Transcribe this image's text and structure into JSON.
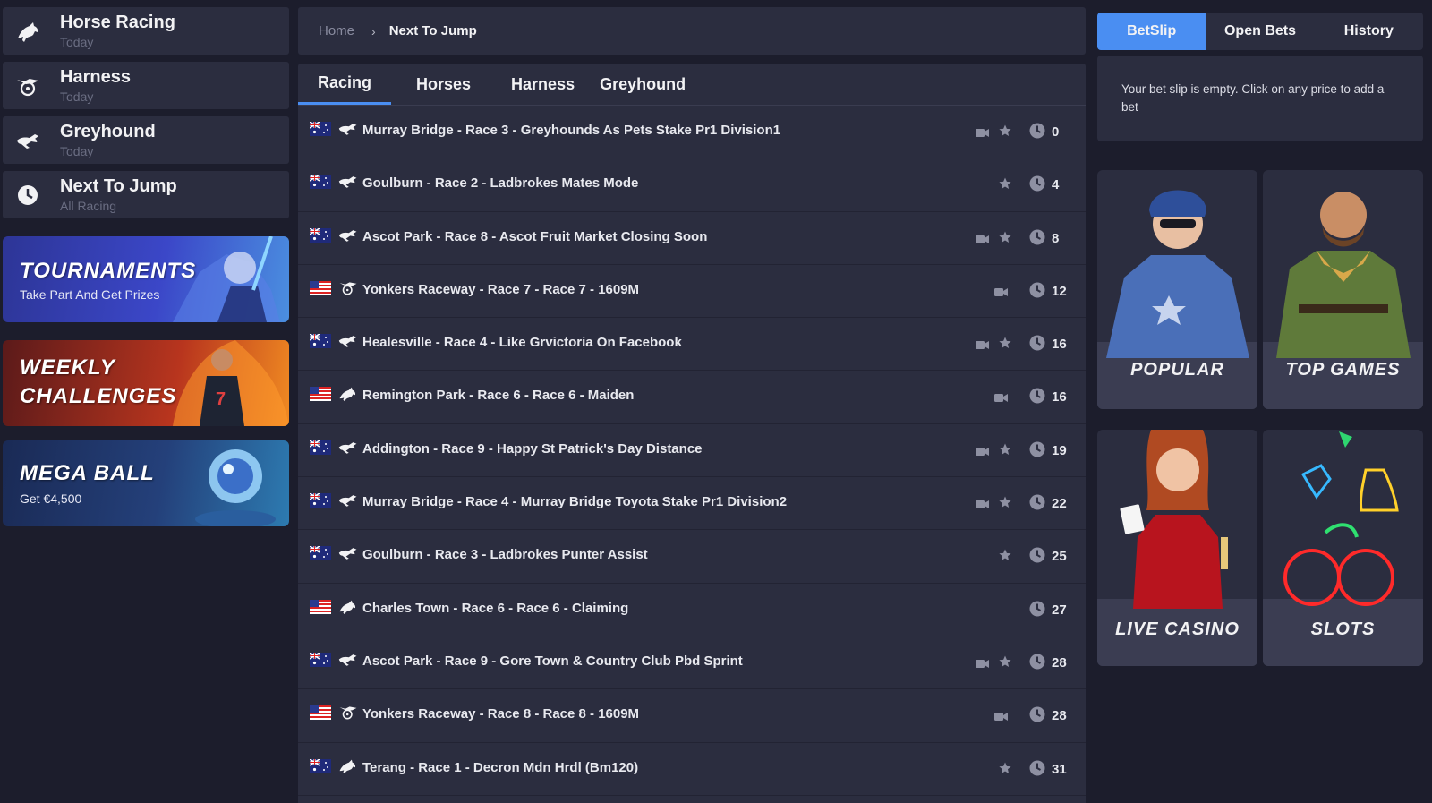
{
  "sidebar": {
    "items": [
      {
        "title": "Horse Racing",
        "subtitle": "Today",
        "icon": "horse-icon"
      },
      {
        "title": "Harness",
        "subtitle": "Today",
        "icon": "harness-icon"
      },
      {
        "title": "Greyhound",
        "subtitle": "Today",
        "icon": "greyhound-icon"
      },
      {
        "title": "Next To Jump",
        "subtitle": "All Racing",
        "icon": "clock-icon"
      }
    ],
    "promos": [
      {
        "title": "TOURNAMENTS",
        "subtitle": "Take Part And Get Prizes"
      },
      {
        "title_line1": "WEEKLY",
        "title_line2": "CHALLENGES"
      },
      {
        "title": "MEGA BALL",
        "subtitle": "Get €4,500"
      }
    ]
  },
  "breadcrumb": {
    "home": "Home",
    "separator": "›",
    "current": "Next To Jump"
  },
  "tabs": [
    "Racing",
    "Horses",
    "Harness",
    "Greyhound"
  ],
  "active_tab": "Racing",
  "races": [
    {
      "flag": "au",
      "type": "greyhound",
      "name": "Murray Bridge - Race 3 - Greyhounds As Pets Stake Pr1 Division1",
      "video": true,
      "fav": true,
      "mins": "0"
    },
    {
      "flag": "au",
      "type": "greyhound",
      "name": "Goulburn - Race 2 - Ladbrokes Mates Mode",
      "video": false,
      "fav": true,
      "mins": "4"
    },
    {
      "flag": "au",
      "type": "greyhound",
      "name": "Ascot Park - Race 8 - Ascot Fruit Market Closing Soon",
      "video": true,
      "fav": true,
      "mins": "8"
    },
    {
      "flag": "us",
      "type": "harness",
      "name": "Yonkers Raceway - Race 7 - Race 7 - 1609M",
      "video": true,
      "fav": false,
      "mins": "12"
    },
    {
      "flag": "au",
      "type": "greyhound",
      "name": "Healesville - Race 4 - Like Grvictoria On Facebook",
      "video": true,
      "fav": true,
      "mins": "16"
    },
    {
      "flag": "us",
      "type": "horse",
      "name": "Remington Park - Race 6 - Race 6 - Maiden",
      "video": true,
      "fav": false,
      "mins": "16"
    },
    {
      "flag": "au",
      "type": "greyhound",
      "name": "Addington - Race 9 - Happy St Patrick's Day Distance",
      "video": true,
      "fav": true,
      "mins": "19"
    },
    {
      "flag": "au",
      "type": "greyhound",
      "name": "Murray Bridge - Race 4 - Murray Bridge Toyota Stake Pr1 Division2",
      "video": true,
      "fav": true,
      "mins": "22"
    },
    {
      "flag": "au",
      "type": "greyhound",
      "name": "Goulburn - Race 3 - Ladbrokes Punter Assist",
      "video": false,
      "fav": true,
      "mins": "25"
    },
    {
      "flag": "us",
      "type": "horse",
      "name": "Charles Town - Race 6 - Race 6 - Claiming",
      "video": false,
      "fav": false,
      "mins": "27"
    },
    {
      "flag": "au",
      "type": "greyhound",
      "name": "Ascot Park - Race 9 - Gore Town & Country Club Pbd Sprint",
      "video": true,
      "fav": true,
      "mins": "28"
    },
    {
      "flag": "us",
      "type": "harness",
      "name": "Yonkers Raceway - Race 8 - Race 8 - 1609M",
      "video": true,
      "fav": false,
      "mins": "28"
    },
    {
      "flag": "au",
      "type": "horse",
      "name": "Terang - Race 1 - Decron Mdn Hrdl (Bm120)",
      "video": false,
      "fav": true,
      "mins": "31"
    }
  ],
  "betslip": {
    "tabs": [
      "BetSlip",
      "Open Bets",
      "History"
    ],
    "active": "BetSlip",
    "empty_message": "Your bet slip is empty. Click on any price to add a bet"
  },
  "tiles": [
    "POPULAR",
    "TOP GAMES",
    "LIVE CASINO",
    "SLOTS"
  ],
  "colors": {
    "accent": "#4a8ef2",
    "panel": "#2b2d3f",
    "background": "#1c1d2c"
  }
}
